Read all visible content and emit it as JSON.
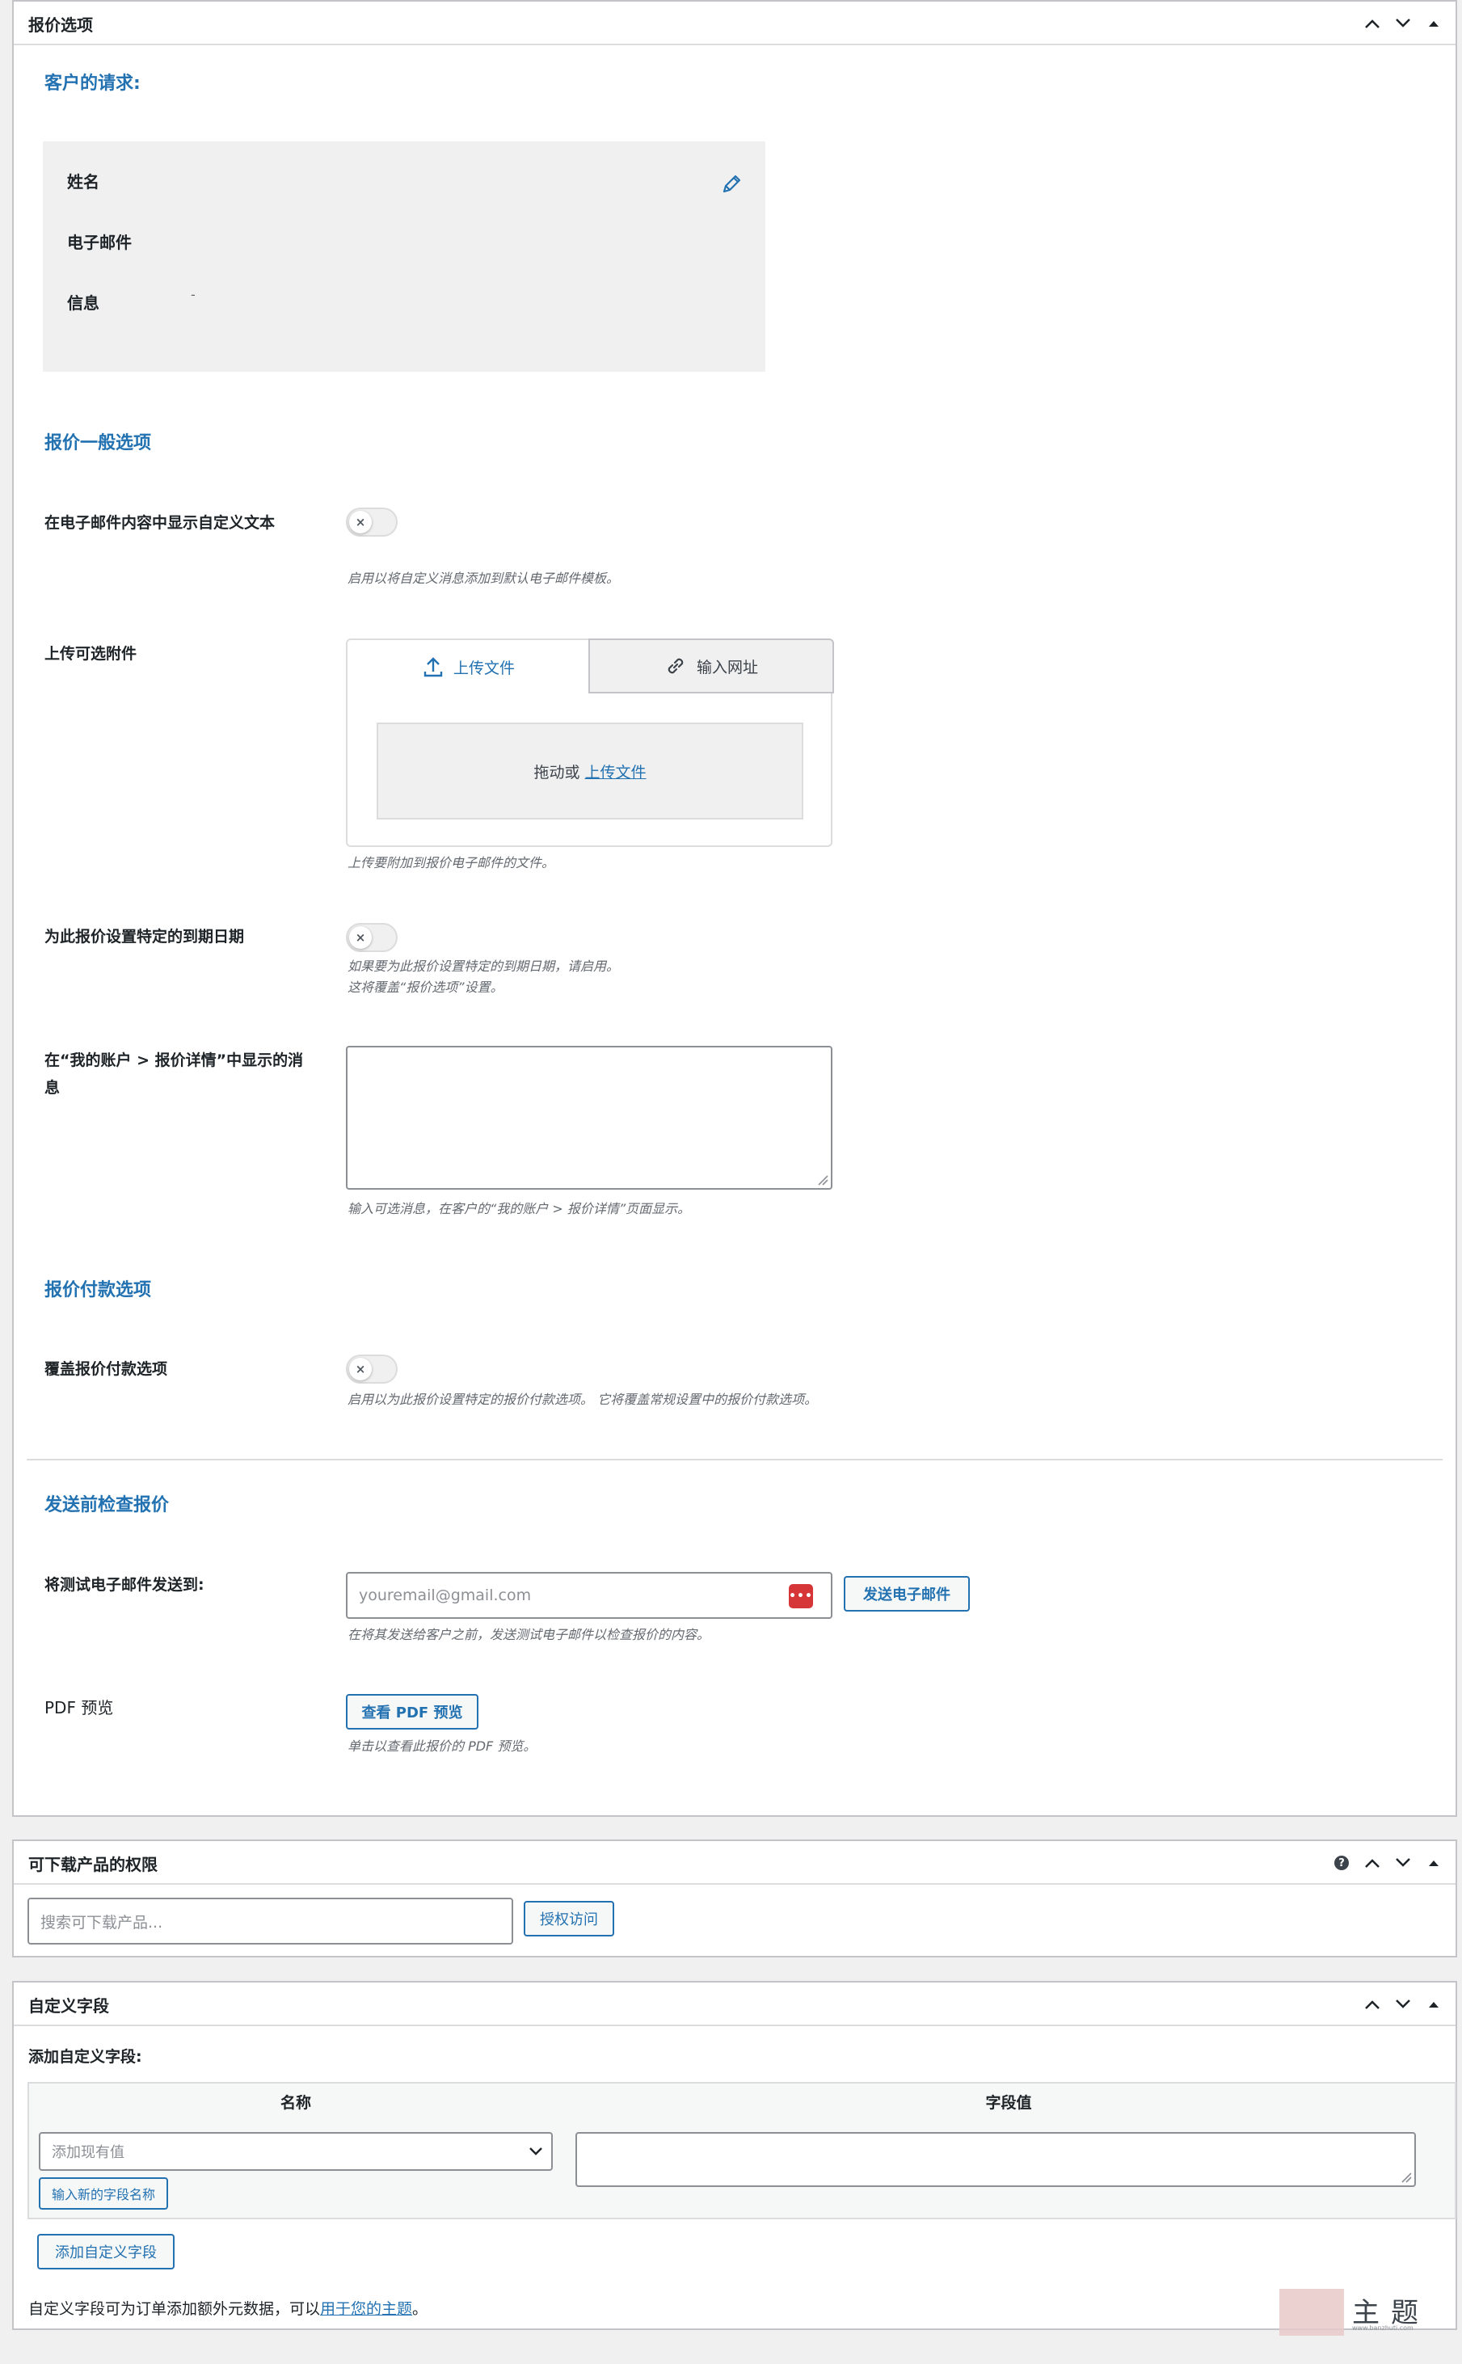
{
  "quote_box": {
    "title": "报价选项",
    "customer_request": {
      "heading": "客户的请求:",
      "name_label": "姓名",
      "email_label": "电子邮件",
      "message_label": "信息",
      "message_value": "-"
    },
    "general": {
      "heading": "报价一般选项",
      "custom_text_label": "在电子邮件内容中显示自定义文本",
      "custom_text_desc": "启用以将自定义消息添加到默认电子邮件模板。",
      "attach_label": "上传可选附件",
      "tab_upload": "上传文件",
      "tab_url": "输入网址",
      "drop_text": "拖动或",
      "drop_link": "上传文件",
      "attach_desc": "上传要附加到报价电子邮件的文件。",
      "expiry_label": "为此报价设置特定的到期日期",
      "expiry_desc_1": "如果要为此报价设置特定的到期日期，请启用。",
      "expiry_desc_2": "这将覆盖“报价选项”设置。",
      "account_msg_label": "在“我的账户 > 报价详情”中显示的消息",
      "account_msg_desc": "输入可选消息，在客户的“我的账户 > 报价详情”页面显示。"
    },
    "payment": {
      "heading": "报价付款选项",
      "override_label": "覆盖报价付款选项",
      "override_desc": "启用以为此报价设置特定的报价付款选项。 它将覆盖常规设置中的报价付款选项。"
    },
    "check": {
      "heading": "发送前检查报价",
      "test_email_label": "将测试电子邮件发送到:",
      "test_email_placeholder": "youremail@gmail.com",
      "send_button": "发送电子邮件",
      "test_email_desc": "在将其发送给客户之前，发送测试电子邮件以检查报价的内容。",
      "pdf_label": "PDF 预览",
      "pdf_button": "查看 PDF 预览",
      "pdf_desc": "单击以查看此报价的 PDF 预览。"
    }
  },
  "download_box": {
    "title": "可下载产品的权限",
    "search_placeholder": "搜索可下载产品...",
    "grant_button": "授权访问"
  },
  "custom_fields_box": {
    "title": "自定义字段",
    "add_label": "添加自定义字段:",
    "col_name": "名称",
    "col_value": "字段值",
    "select_placeholder": "添加现有值",
    "new_name_button": "输入新的字段名称",
    "add_button": "添加自定义字段",
    "footer_text": "自定义字段可为订单添加额外元数据，可以",
    "footer_link": "用于您的主题",
    "footer_end": "。"
  },
  "watermark": {
    "main": "主题",
    "url": "www.banzhuti.com"
  },
  "colors": {
    "accent": "#2271b1",
    "border": "#c3c4c7",
    "background": "#f0f0f1",
    "password_icon": "#d63638"
  }
}
